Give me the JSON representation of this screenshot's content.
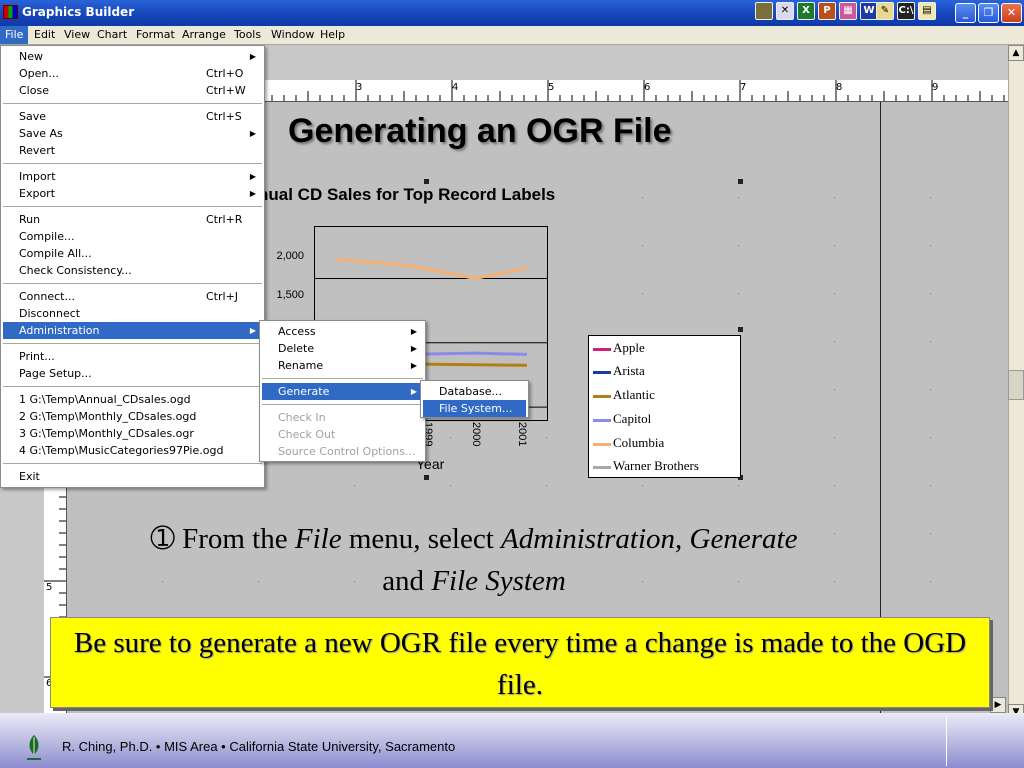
{
  "window": {
    "title": "Graphics Builder"
  },
  "menubar": [
    "File",
    "Edit",
    "View",
    "Chart",
    "Format",
    "Arrange",
    "Tools",
    "Window",
    "Help"
  ],
  "ruler": {
    "h_numbers": [
      "3",
      "4",
      "5",
      "6",
      "7",
      "8",
      "9"
    ],
    "v_numbers": [
      "5",
      "6"
    ]
  },
  "slide": {
    "title": "Generating an OGR File",
    "instruction": {
      "marker": "➀",
      "p1": " From the ",
      "e1": "File",
      "p2": " menu, select ",
      "e2": "Administration",
      "p3": ", ",
      "e3": "Generate",
      "p4": " and ",
      "e4": "File System"
    },
    "note": "Be sure to generate a new OGR file every time a change is made to the OGD file."
  },
  "chart_data": {
    "type": "line",
    "title": "nual CD Sales for Top Record Labels",
    "xlabel": "Year",
    "ylabel": "",
    "x": [
      "1999",
      "2000",
      "2001"
    ],
    "y_ticks": [
      "2,000",
      "1,500"
    ],
    "ylim": [
      900,
      2400
    ],
    "series": [
      {
        "name": "Apple",
        "color": "#d0207a",
        "values": [
          1000,
          1020,
          1010,
          1000
        ]
      },
      {
        "name": "Arista",
        "color": "#1a3aa8",
        "values": [
          1040,
          1050,
          1080,
          1075
        ]
      },
      {
        "name": "Atlantic",
        "color": "#b08010",
        "values": [
          1340,
          1335,
          1330,
          1325
        ]
      },
      {
        "name": "Capitol",
        "color": "#8a8ae8",
        "values": [
          1400,
          1410,
          1420,
          1410
        ]
      },
      {
        "name": "Columbia",
        "color": "#f8b070",
        "values": [
          2150,
          2100,
          2000,
          2080
        ]
      },
      {
        "name": "Warner Brothers",
        "color": "#a8a8a8",
        "values": [
          940,
          950,
          960,
          955
        ]
      }
    ]
  },
  "file_menu": {
    "items": [
      {
        "label": "New",
        "shortcut": "",
        "submenu": true
      },
      {
        "label": "Open...",
        "shortcut": "Ctrl+O"
      },
      {
        "label": "Close",
        "shortcut": "Ctrl+W"
      },
      {
        "sep": true
      },
      {
        "label": "Save",
        "shortcut": "Ctrl+S"
      },
      {
        "label": "Save As",
        "shortcut": "",
        "submenu": true
      },
      {
        "label": "Revert",
        "shortcut": ""
      },
      {
        "sep": true
      },
      {
        "label": "Import",
        "shortcut": "",
        "submenu": true
      },
      {
        "label": "Export",
        "shortcut": "",
        "submenu": true
      },
      {
        "sep": true
      },
      {
        "label": "Run",
        "shortcut": "Ctrl+R"
      },
      {
        "label": "Compile...",
        "shortcut": ""
      },
      {
        "label": "Compile All...",
        "shortcut": ""
      },
      {
        "label": "Check Consistency...",
        "shortcut": ""
      },
      {
        "sep": true
      },
      {
        "label": "Connect...",
        "shortcut": "Ctrl+J"
      },
      {
        "label": "Disconnect",
        "shortcut": ""
      },
      {
        "label": "Administration",
        "shortcut": "",
        "submenu": true,
        "selected": true
      },
      {
        "sep": true
      },
      {
        "label": "Print...",
        "shortcut": ""
      },
      {
        "label": "Page Setup...",
        "shortcut": ""
      },
      {
        "sep": true
      },
      {
        "label": "1 G:\\Temp\\Annual_CDsales.ogd",
        "shortcut": ""
      },
      {
        "label": "2 G:\\Temp\\Monthly_CDsales.ogd",
        "shortcut": ""
      },
      {
        "label": "3 G:\\Temp\\Monthly_CDsales.ogr",
        "shortcut": ""
      },
      {
        "label": "4 G:\\Temp\\MusicCategories97Pie.ogd",
        "shortcut": ""
      },
      {
        "sep": true
      },
      {
        "label": "Exit",
        "shortcut": ""
      }
    ]
  },
  "admin_menu": {
    "items": [
      {
        "label": "Access",
        "submenu": true
      },
      {
        "label": "Delete",
        "submenu": true
      },
      {
        "label": "Rename",
        "submenu": true
      },
      {
        "sep": true
      },
      {
        "label": "Generate",
        "submenu": true,
        "selected": true
      },
      {
        "sep": true
      },
      {
        "label": "Check In",
        "disabled": true
      },
      {
        "label": "Check Out",
        "disabled": true
      },
      {
        "label": "Source Control Options...",
        "disabled": true
      }
    ]
  },
  "generate_menu": {
    "items": [
      {
        "label": "Database..."
      },
      {
        "label": "File System...",
        "selected": true
      }
    ]
  },
  "footer": {
    "text": "R. Ching, Ph.D. • MIS Area  • California State University, Sacramento"
  },
  "colors": {
    "titlebar": "#1a4cc0",
    "selection": "#316ac5",
    "note_bg": "#ffff00"
  }
}
